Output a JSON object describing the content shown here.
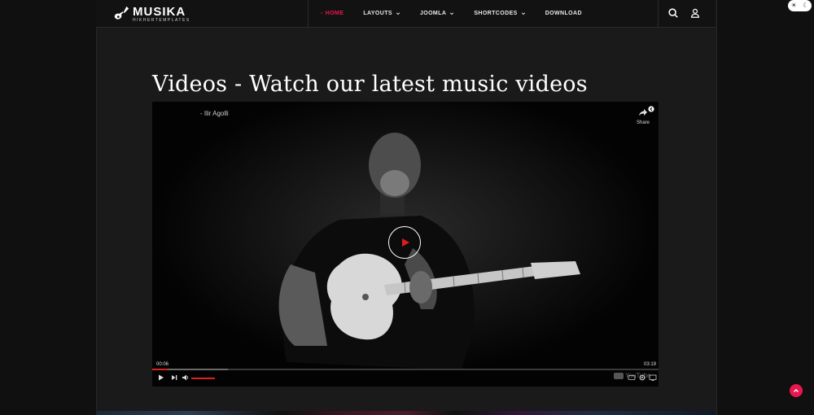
{
  "header": {
    "logo": {
      "name": "MUSIKA",
      "tagline": "HIKHERTEMPLATES"
    },
    "nav": [
      {
        "label": "HOME",
        "active": true,
        "has_dropdown": false
      },
      {
        "label": "LAYOUTS",
        "active": false,
        "has_dropdown": true
      },
      {
        "label": "JOOMLA",
        "active": false,
        "has_dropdown": true
      },
      {
        "label": "SHORTCODES",
        "active": false,
        "has_dropdown": true
      },
      {
        "label": "DOWNLOAD",
        "active": false,
        "has_dropdown": false
      }
    ],
    "active_prefix": "-",
    "icons": {
      "search": "search-icon",
      "user": "user-icon"
    }
  },
  "theme_toggle": {
    "light_icon": "☀",
    "dark_icon": "☾"
  },
  "page": {
    "title": "Videos - Watch our latest music videos"
  },
  "video": {
    "title": "- Ilir Agolli",
    "share_label": "Share",
    "current_time": "00:06",
    "duration": "03:19",
    "progress": 0.03,
    "buffered": 0.15,
    "volume": 1.0,
    "watermark": "YouTube",
    "icons": [
      "play-icon",
      "next-icon",
      "volume-icon",
      "share-icon",
      "captions-icon",
      "settings-icon",
      "cast-icon"
    ]
  },
  "colors": {
    "accent": "#e8174f",
    "youtube_red": "#e02020",
    "background": "#101010",
    "panel": "#1a1a1a"
  }
}
